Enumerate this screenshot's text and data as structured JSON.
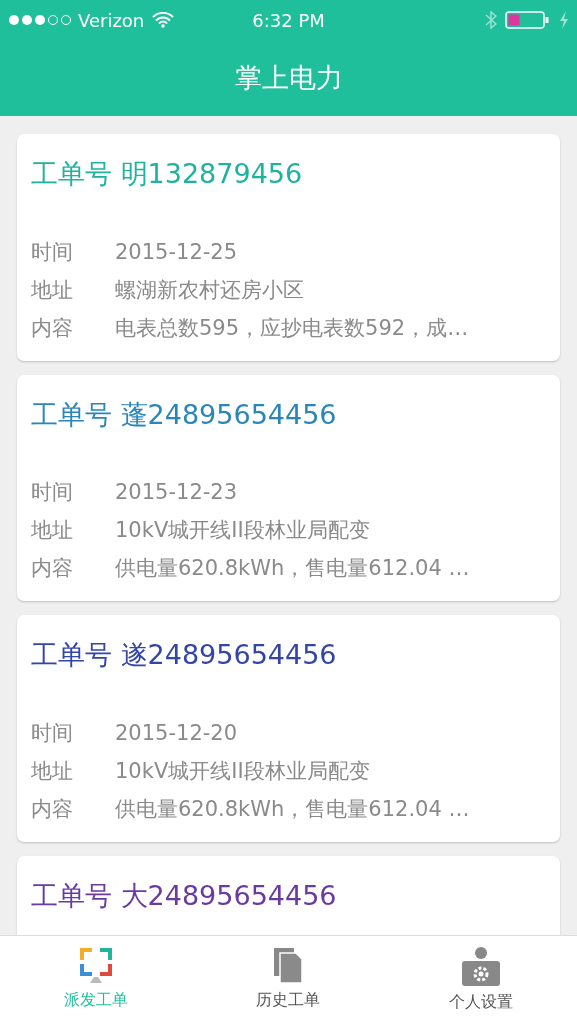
{
  "status_bar": {
    "carrier": "Verizon",
    "time": "6:32 PM"
  },
  "header": {
    "title": "掌上电力"
  },
  "orders": [
    {
      "title": "工单号 明132879456",
      "color": "#1fb29f",
      "fields": [
        {
          "label": "时间",
          "value": "2015-12-25"
        },
        {
          "label": "地址",
          "value": "螺湖新农村还房小区"
        },
        {
          "label": "内容",
          "value": "电表总数595，应抄电表数592，成…"
        }
      ]
    },
    {
      "title": "工单号 蓬24895654456",
      "color": "#2a86b8",
      "fields": [
        {
          "label": "时间",
          "value": "2015-12-23"
        },
        {
          "label": "地址",
          "value": "10kV城开线II段林业局配变"
        },
        {
          "label": "内容",
          "value": "供电量620.8kWh，售电量612.04 …"
        }
      ]
    },
    {
      "title": "工单号 遂24895654456",
      "color": "#3445a8",
      "fields": [
        {
          "label": "时间",
          "value": "2015-12-20"
        },
        {
          "label": "地址",
          "value": "10kV城开线II段林业局配变"
        },
        {
          "label": "内容",
          "value": "供电量620.8kWh，售电量612.04 …"
        }
      ]
    },
    {
      "title": "工单号 大24895654456",
      "color": "#6a3aa0"
    }
  ],
  "tabs": [
    {
      "kind": "dispatch",
      "label": "派发工单",
      "selected": true
    },
    {
      "kind": "history",
      "label": "历史工单",
      "selected": false
    },
    {
      "kind": "profile",
      "label": "个人设置",
      "selected": false
    }
  ]
}
